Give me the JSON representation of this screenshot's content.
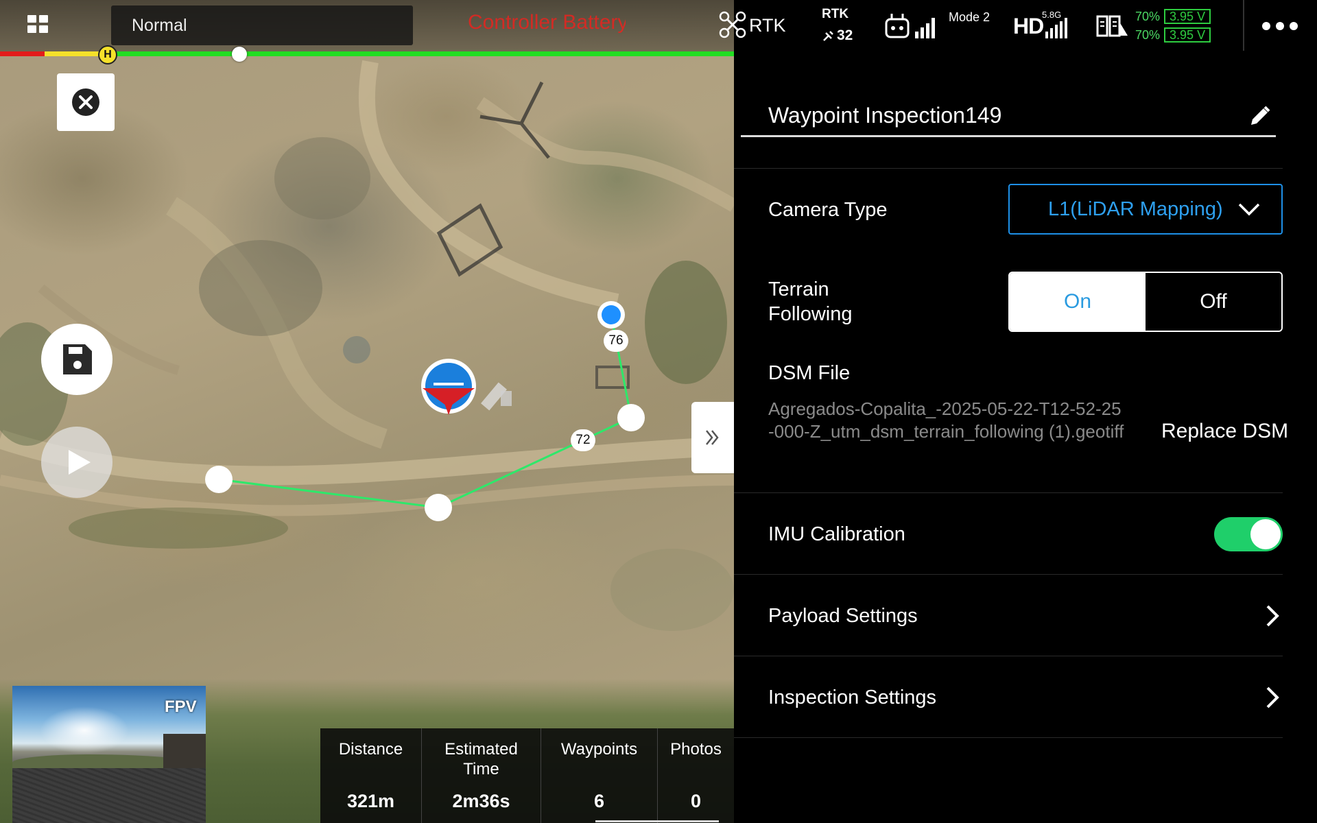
{
  "top_bar": {
    "flight_mode": "Normal",
    "warning_text": "Controller Battery",
    "rtk_label": "RTK",
    "rtk_sat_label": "RTK",
    "rtk_sat_count": "32",
    "rc_mode": "Mode 2",
    "hd_label": "HD",
    "hd_band": "5.8G",
    "battery": [
      {
        "percent": "70%",
        "voltage": "3.95 V"
      },
      {
        "percent": "70%",
        "voltage": "3.95 V"
      }
    ],
    "icons": [
      "apps-grid-icon",
      "drone-icon",
      "satellite-icon",
      "remote-controller-icon",
      "signal-bars-icon",
      "battery-icon",
      "more-icon"
    ]
  },
  "map": {
    "home_marker": "H",
    "waypoint_labels": [
      "76",
      "72"
    ],
    "fpv_label": "FPV",
    "route_color": "#2ee86a",
    "icons": [
      "close-icon",
      "save-icon",
      "play-icon",
      "double-chevron-right-icon"
    ]
  },
  "stats": [
    {
      "label": "Distance",
      "value": "321m"
    },
    {
      "label": "Estimated Time",
      "value": "2m36s"
    },
    {
      "label": "Waypoints",
      "value": "6"
    },
    {
      "label": "Photos",
      "value": "0"
    }
  ],
  "panel": {
    "mission_name": "Waypoint Inspection149",
    "camera_type_label": "Camera Type",
    "camera_type_value": "L1(LiDAR Mapping)",
    "terrain_label": "Terrain Following",
    "terrain_on": "On",
    "terrain_off": "Off",
    "dsm_label": "DSM File",
    "dsm_file": "Agregados-Copalita_-2025-05-22-T12-52-25-000-Z_utm_dsm_terrain_following (1).geotiff",
    "replace_dsm": "Replace DSM",
    "imu_label": "IMU Calibration",
    "imu_enabled": true,
    "payload_settings": "Payload Settings",
    "inspection_settings": "Inspection Settings",
    "accent_color": "#1e90e8",
    "toggle_color": "#1fcf6a"
  }
}
